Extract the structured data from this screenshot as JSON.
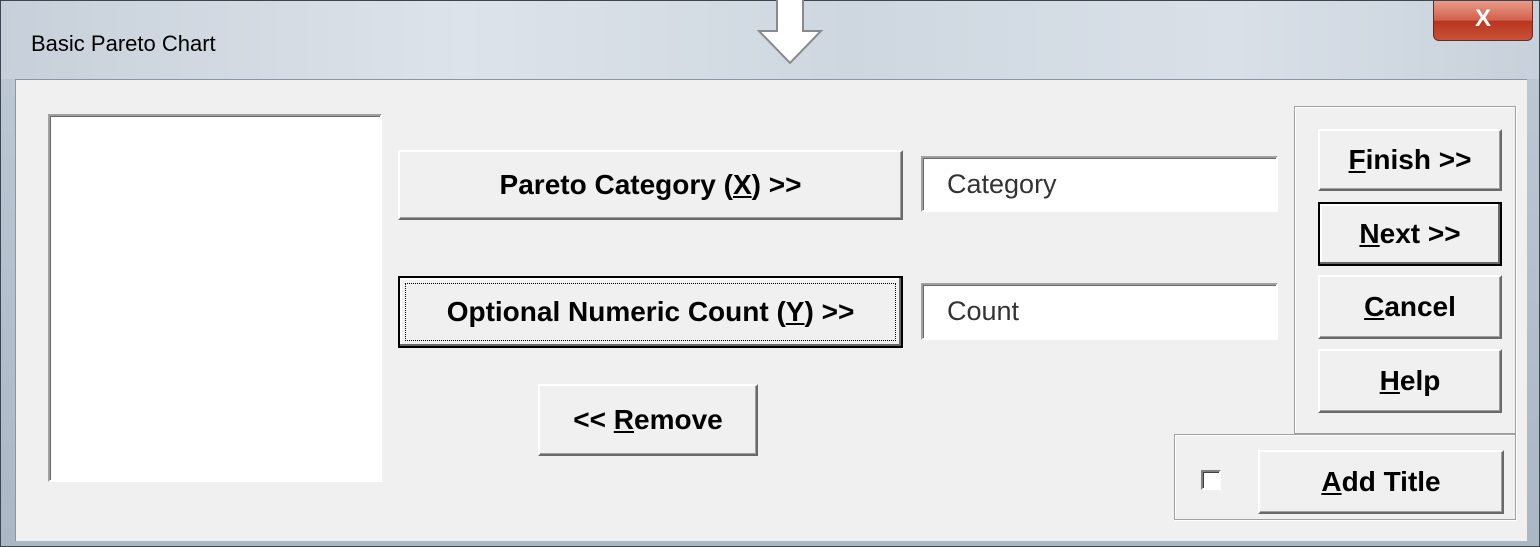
{
  "window": {
    "title": "Basic Pareto Chart",
    "close_label": "X"
  },
  "fields": {
    "category_value": "Category",
    "count_value": "Count"
  },
  "buttons": {
    "pareto_category": {
      "prefix": "Pareto Category (",
      "accel": "X",
      "suffix": ") >>"
    },
    "numeric_count": {
      "prefix": "Optional Numeric Count (",
      "accel": "Y",
      "suffix": ") >>"
    },
    "remove": {
      "prefix": "<< ",
      "accel": "R",
      "suffix": "emove"
    },
    "finish": {
      "prefix": "",
      "accel": "F",
      "suffix": "inish >>"
    },
    "next": {
      "prefix": "",
      "accel": "N",
      "suffix": "ext >>"
    },
    "cancel": {
      "prefix": "",
      "accel": "C",
      "suffix": "ancel"
    },
    "help": {
      "prefix": "",
      "accel": "H",
      "suffix": "elp"
    },
    "add_title": {
      "prefix": "",
      "accel": "A",
      "suffix": "dd Title"
    }
  },
  "add_title_checked": false,
  "icons": {
    "arrow": "down-arrow-icon",
    "close": "close-icon"
  }
}
